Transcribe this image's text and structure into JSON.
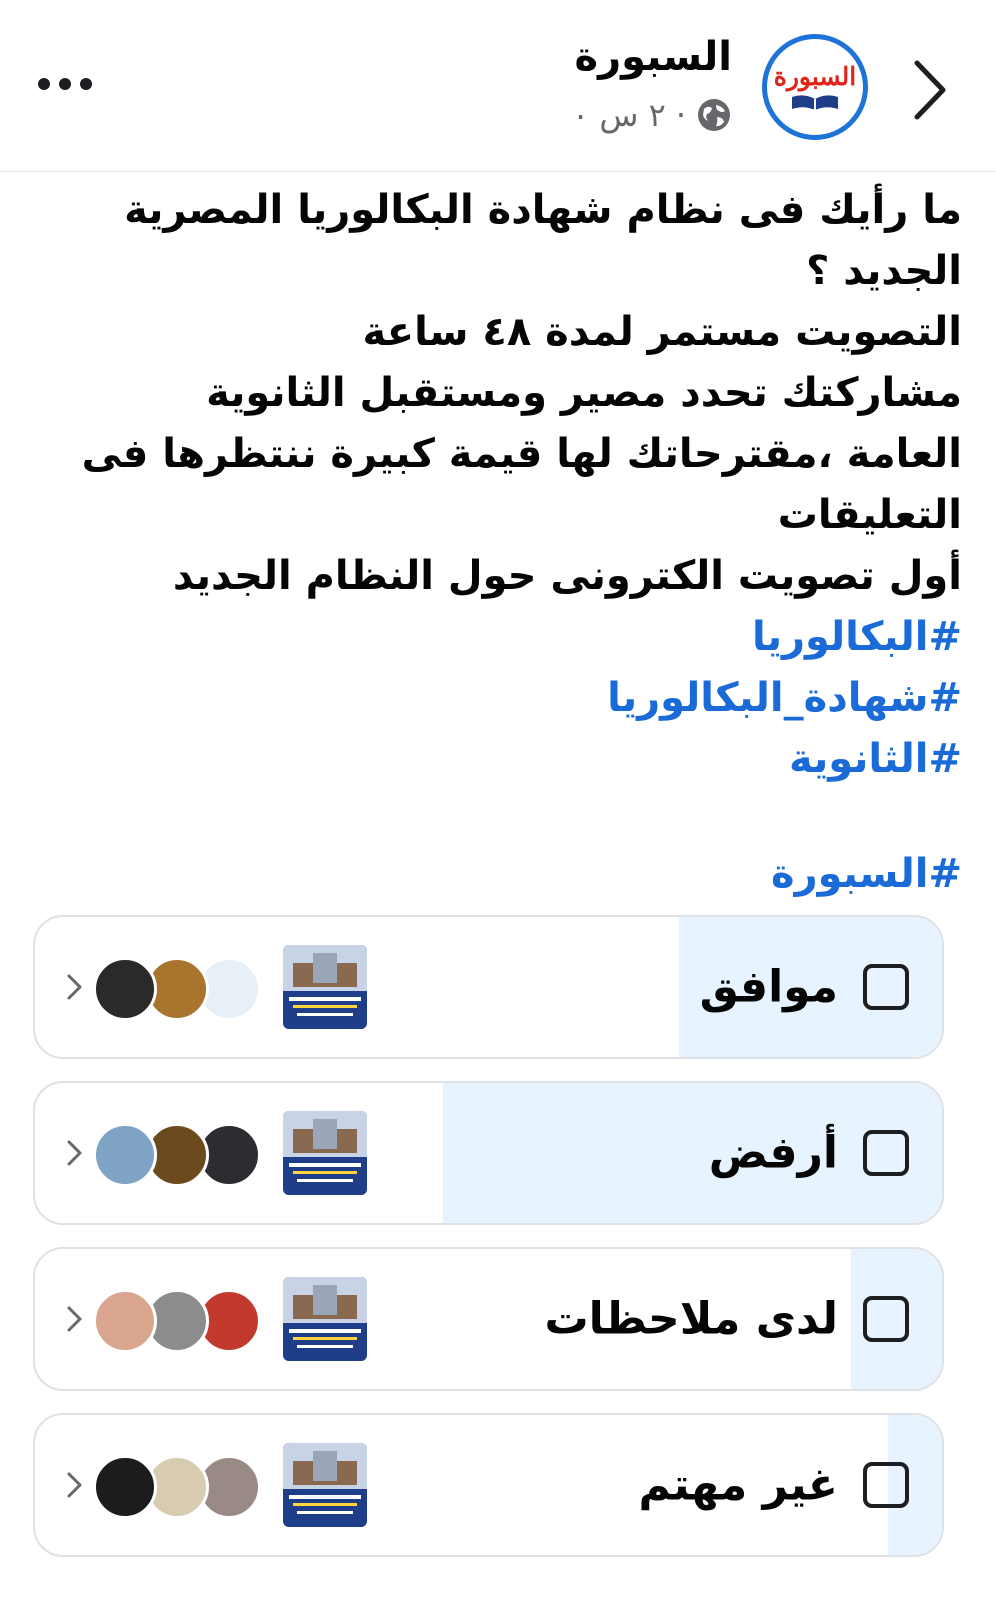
{
  "header": {
    "page_name": "السبورة",
    "timestamp": "٢ س ٠",
    "logo_text": "السبورة",
    "back_icon": "chevron-right-icon",
    "more_icon": "more-horizontal-icon",
    "privacy_icon": "globe-icon"
  },
  "post": {
    "lines": [
      "ما رأيك فى نظام شهادة البكالوريا المصرية",
      "الجديد ؟",
      "التصويت مستمر لمدة ٤٨ ساعة",
      "مشاركتك تحدد مصير ومستقبل الثانوية",
      "العامة ،مقترحاتك لها قيمة كبيرة ننتظرها  فى",
      "التعليقات",
      "أول تصويت الكترونى حول النظام الجديد"
    ],
    "hashtags": [
      "#البكالوريا",
      "#شهادة_البكالوريا",
      "#الثانوية"
    ],
    "last_hashtag": "#السبورة"
  },
  "poll": {
    "accent_fill": "#e7f3ff",
    "options": [
      {
        "label": "موافق",
        "fill_fraction": 0.29
      },
      {
        "label": "أرفض",
        "fill_fraction": 0.55
      },
      {
        "label": "لدى ملاحظات",
        "fill_fraction": 0.1
      },
      {
        "label": "غير مهتم",
        "fill_fraction": 0.06
      }
    ]
  }
}
